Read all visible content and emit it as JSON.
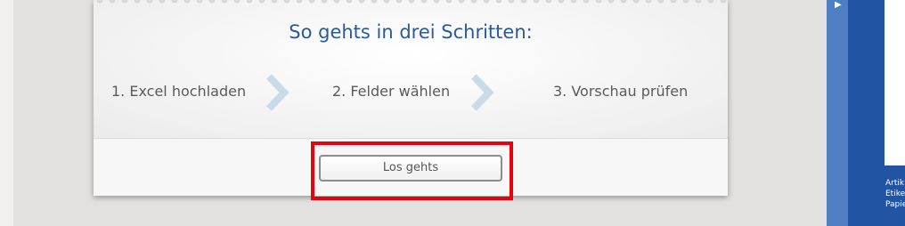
{
  "steps_card": {
    "title": "So gehts in drei Schritten:",
    "steps": [
      {
        "label": "1. Excel hochladen"
      },
      {
        "label": "2. Felder wählen"
      },
      {
        "label": "3. Vorschau prüfen"
      }
    ],
    "go_button_label": "Los gehts"
  },
  "side_panel": {
    "lines": [
      "Artik",
      "Etike",
      "Papie"
    ]
  },
  "colors": {
    "title": "#2a5a9e",
    "chevron": "#c9dbe6",
    "highlight": "#e8000b",
    "side_panel": "#2154a2"
  },
  "icons": {
    "step_separator": "chevron-right-icon",
    "panel_toggle": "triangle-right-icon"
  }
}
